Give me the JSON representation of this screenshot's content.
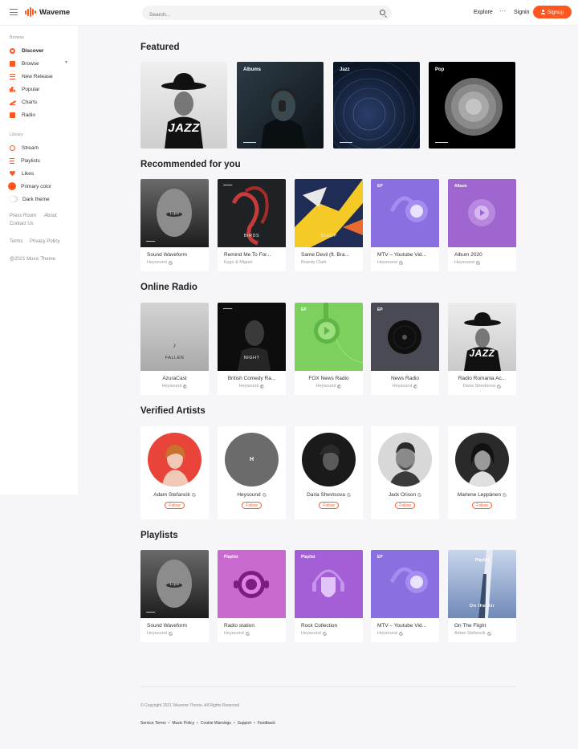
{
  "app": {
    "name": "Waveme"
  },
  "search": {
    "placeholder": "Search..."
  },
  "topnav": {
    "explore": "Explore",
    "more": "···",
    "signin": "Signin",
    "signup": "Signup"
  },
  "colors": {
    "accent": "#ff5722"
  },
  "sidebar": {
    "browse_heading": "Browse",
    "browse": [
      {
        "label": "Discover",
        "icon": "compass-icon"
      },
      {
        "label": "Browse",
        "icon": "grid-icon"
      },
      {
        "label": "New Release",
        "icon": "list-icon"
      },
      {
        "label": "Popular",
        "icon": "bars-icon"
      },
      {
        "label": "Charts",
        "icon": "trend-icon"
      },
      {
        "label": "Radio",
        "icon": "radio-icon"
      }
    ],
    "library_heading": "Library",
    "library": [
      {
        "label": "Stream",
        "icon": "stream-icon"
      },
      {
        "label": "Playlists",
        "icon": "playlist-icon"
      },
      {
        "label": "Likes",
        "icon": "heart-icon"
      },
      {
        "label": "Primary color",
        "icon": "color-icon"
      },
      {
        "label": "Dark theme",
        "icon": "toggle-icon"
      }
    ],
    "links": {
      "press": "Press Room",
      "about": "About",
      "contact": "Contact Us",
      "terms": "Terms",
      "privacy": "Privacy Policy",
      "copyright": "@2021 Music Theme"
    }
  },
  "featured": {
    "title": "Featured",
    "items": [
      {
        "label": "",
        "caption": "JAZZ"
      },
      {
        "label": "Albums",
        "caption": ""
      },
      {
        "label": "Jazz",
        "caption": ""
      },
      {
        "label": "Pop",
        "caption": ""
      }
    ]
  },
  "recommended": {
    "title": "Recommended for you",
    "items": [
      {
        "title": "Sound Waveform",
        "artist": "Heysound",
        "verified": true,
        "img_text": "Lips",
        "tag": ""
      },
      {
        "title": "Remind Me To For...",
        "artist": "Kygo & Miguel",
        "verified": false,
        "img_text": "BIRDS",
        "tag": ""
      },
      {
        "title": "Same Devil (ft. Bra...",
        "artist": "Brandy Clark",
        "verified": false,
        "img_text": "SLEEP",
        "tag": ""
      },
      {
        "title": "MTV – Youtube Vid...",
        "artist": "Heysound",
        "verified": true,
        "img_text": "",
        "tag": "EP"
      },
      {
        "title": "Album 2020",
        "artist": "Heysound",
        "verified": true,
        "img_text": "",
        "tag": "Album"
      }
    ]
  },
  "radio": {
    "title": "Online Radio",
    "items": [
      {
        "title": "AzuraCast",
        "artist": "Heysound",
        "img_text": "FALLEN",
        "tag": ""
      },
      {
        "title": "British Comedy Ra...",
        "artist": "Heysound",
        "img_text": "NIGHT",
        "tag": ""
      },
      {
        "title": "FOX News Radio",
        "artist": "Heysound",
        "img_text": "",
        "tag": "EP"
      },
      {
        "title": "News Radio",
        "artist": "Heysound",
        "img_text": "",
        "tag": "EP"
      },
      {
        "title": "Radio Romania Ac...",
        "artist": "Daria Shevtsova",
        "img_text": "JAZZ",
        "tag": ""
      }
    ]
  },
  "artists": {
    "title": "Verified Artists",
    "follow_label": "Follow",
    "items": [
      {
        "name": "Adam Stefancik"
      },
      {
        "name": "Heysound",
        "initial": "H"
      },
      {
        "name": "Daria Shevtsova"
      },
      {
        "name": "Jack Orison"
      },
      {
        "name": "Marlene Leppänen"
      }
    ]
  },
  "playlists": {
    "title": "Playlists",
    "items": [
      {
        "title": "Sound Waveform",
        "artist": "Heysound",
        "img_text": "Lips",
        "tag": ""
      },
      {
        "title": "Radio station",
        "artist": "Heysound",
        "img_text": "",
        "tag": "Playlist"
      },
      {
        "title": "Rock Collection",
        "artist": "Heysound",
        "img_text": "",
        "tag": "Playlist"
      },
      {
        "title": "MTV – Youtube Vid...",
        "artist": "Heysound",
        "img_text": "",
        "tag": "EP"
      },
      {
        "title": "On The Flight",
        "artist": "Adam Stefancik",
        "img_text": "On the Air",
        "tag": "Playlist"
      }
    ]
  },
  "footer": {
    "copyright": "© Copyright 2021 Waveme Theme. All Rights Reserved",
    "links": [
      "Service Terms",
      "Music Policy",
      "Cookie Warnings",
      "Support",
      "Feedback"
    ],
    "separator": "•"
  }
}
